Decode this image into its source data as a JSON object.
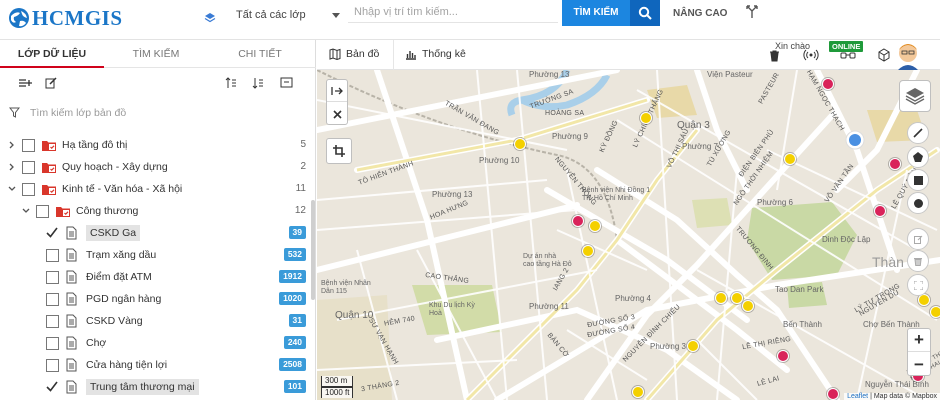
{
  "logo": {
    "text": "HCMGIS"
  },
  "header": {
    "layer_select": "Tất cả các lớp",
    "search_placeholder": "Nhập vị trí tìm kiếm...",
    "search_button": "TÌM KIẾM",
    "advanced": "NÂNG CAO",
    "greeting": "Xin chào",
    "online": "ONLINE"
  },
  "tabs": [
    "LỚP DỮ LIỆU",
    "TÌM KIẾM",
    "CHI TIẾT"
  ],
  "filter": {
    "placeholder": "Tìm kiếm lớp bản đồ"
  },
  "tree": [
    {
      "label": "Hạ tầng đô thị",
      "count": "5"
    },
    {
      "label": "Quy hoạch - Xây dựng",
      "count": "2"
    },
    {
      "label": "Kinh tế - Văn hóa - Xã hội",
      "count": "11"
    },
    {
      "label": "Công thương",
      "count": "12"
    },
    {
      "label": "CSKD Ga",
      "count": "39",
      "checked": true
    },
    {
      "label": "Trạm xăng dầu",
      "count": "532"
    },
    {
      "label": "Điểm đặt ATM",
      "count": "1912"
    },
    {
      "label": "PGD ngân hàng",
      "count": "1020"
    },
    {
      "label": "CSKD Vàng",
      "count": "31"
    },
    {
      "label": "Chợ",
      "count": "240"
    },
    {
      "label": "Cửa hàng tiện lợi",
      "count": "2508"
    },
    {
      "label": "Trung tâm thương mại",
      "count": "101",
      "checked": true
    }
  ],
  "map_tabs": {
    "map": "Bản đồ",
    "stats": "Thống kê"
  },
  "map_labels": {
    "ward13a": "Phường 13",
    "ward9": "Phường 9",
    "quan3": "Quận 3",
    "ward7": "Phường 7",
    "ward10a": "Phường 10",
    "ward13b": "Phường 13",
    "ward6": "Phường 6",
    "ward10b": "Phường 10",
    "ward4": "Phường 4",
    "ward11": "Phường 11",
    "ward3": "Phường 3",
    "quan10": "Quận 10",
    "thanh": "Thàn",
    "tao_dan": "Tao Dan Park",
    "dinh": "Dinh Độc Lập",
    "benh_vien": "Bệnh viện Nhi Đồng 1\nTP. Hồ Chí Minh",
    "du_an": "Dự án nhà\ncao tầng Hà Đô",
    "ky_hoa": "Khu Du lịch Kỳ\nHoà",
    "ben_thanh": "Bến Thành",
    "cho_bt": "Chợ Bến Thành",
    "nguyen_thai_binh": "Nguyễn Thái Bình",
    "bv_nhan": "Bệnh viện Nhân\nDân 115",
    "vien_pasteur": "Viện Pasteur",
    "s_truong_sa": "TRƯỜNG SA",
    "s_hoang_sa": "HOÀNG SA",
    "s_tran_van_dang": "TRẦN VĂN ĐANG",
    "s_to_hien_thanh": "TÔ HIẾN THÀNH",
    "s_hoa_hung": "HOA HƯNG",
    "s_nguyen_thong": "NGUYỄN THÔNG",
    "s_cao_thang": "CAO THẮNG",
    "s_nguyen_dinh_chieu": "NGUYỄN ĐÌNH CHIỂU",
    "s_truong_dinh": "TRƯƠNG ĐỊNH",
    "s_le_thi_rieng": "LÊ THỊ RIÊNG",
    "s_ly_tu_trong": "LÝ TỰ TRỌNG",
    "s_pasteur": "PASTEUR",
    "s_pham_ngoc_thach": "PHẠM NGỌC THẠCH",
    "s_vo_van_tan": "VÕ VĂN TẦN",
    "s_dien_bien_phu": "ĐIỆN BIÊN PHỦ",
    "s_tu_xuong": "TÚ XƯƠNG",
    "s_ngo_thoi_nhiem": "NGÔ THỜI NHIỆM",
    "s_ba_thang_hai": "3 THÁNG 2",
    "s_le_lai": "LÊ LAI",
    "s_ban_co": "BÀN CỜ",
    "s_hem_740": "HẺM 740",
    "s_le_quy_don": "LÊ QUÝ ĐÔN",
    "s_vo_thi_sau": "VÕ THỊ SÁU",
    "s_ly_chinh_thang": "LÝ CHÍNH THẮNG",
    "s_ky_dong": "KỲ ĐỒNG",
    "s_duong_so_3": "ĐƯỜNG SỐ 3",
    "s_duong_so_4": "ĐƯỜNG SỐ 4",
    "s_nguyen_thi_minh_khai": "NGUYỄN THỊ\nMINH KHAI",
    "s_su_van_hanh": "SƯ VẠN HẠNH",
    "s_hang_2": "IANG 2",
    "s_nguyen_du": "NGUYỄN DU"
  },
  "scale": {
    "metric": "300 m",
    "imperial": "1000 ft"
  },
  "attribution": {
    "leaflet": "Leaflet",
    "rest": " | Map data © Mapbox"
  }
}
